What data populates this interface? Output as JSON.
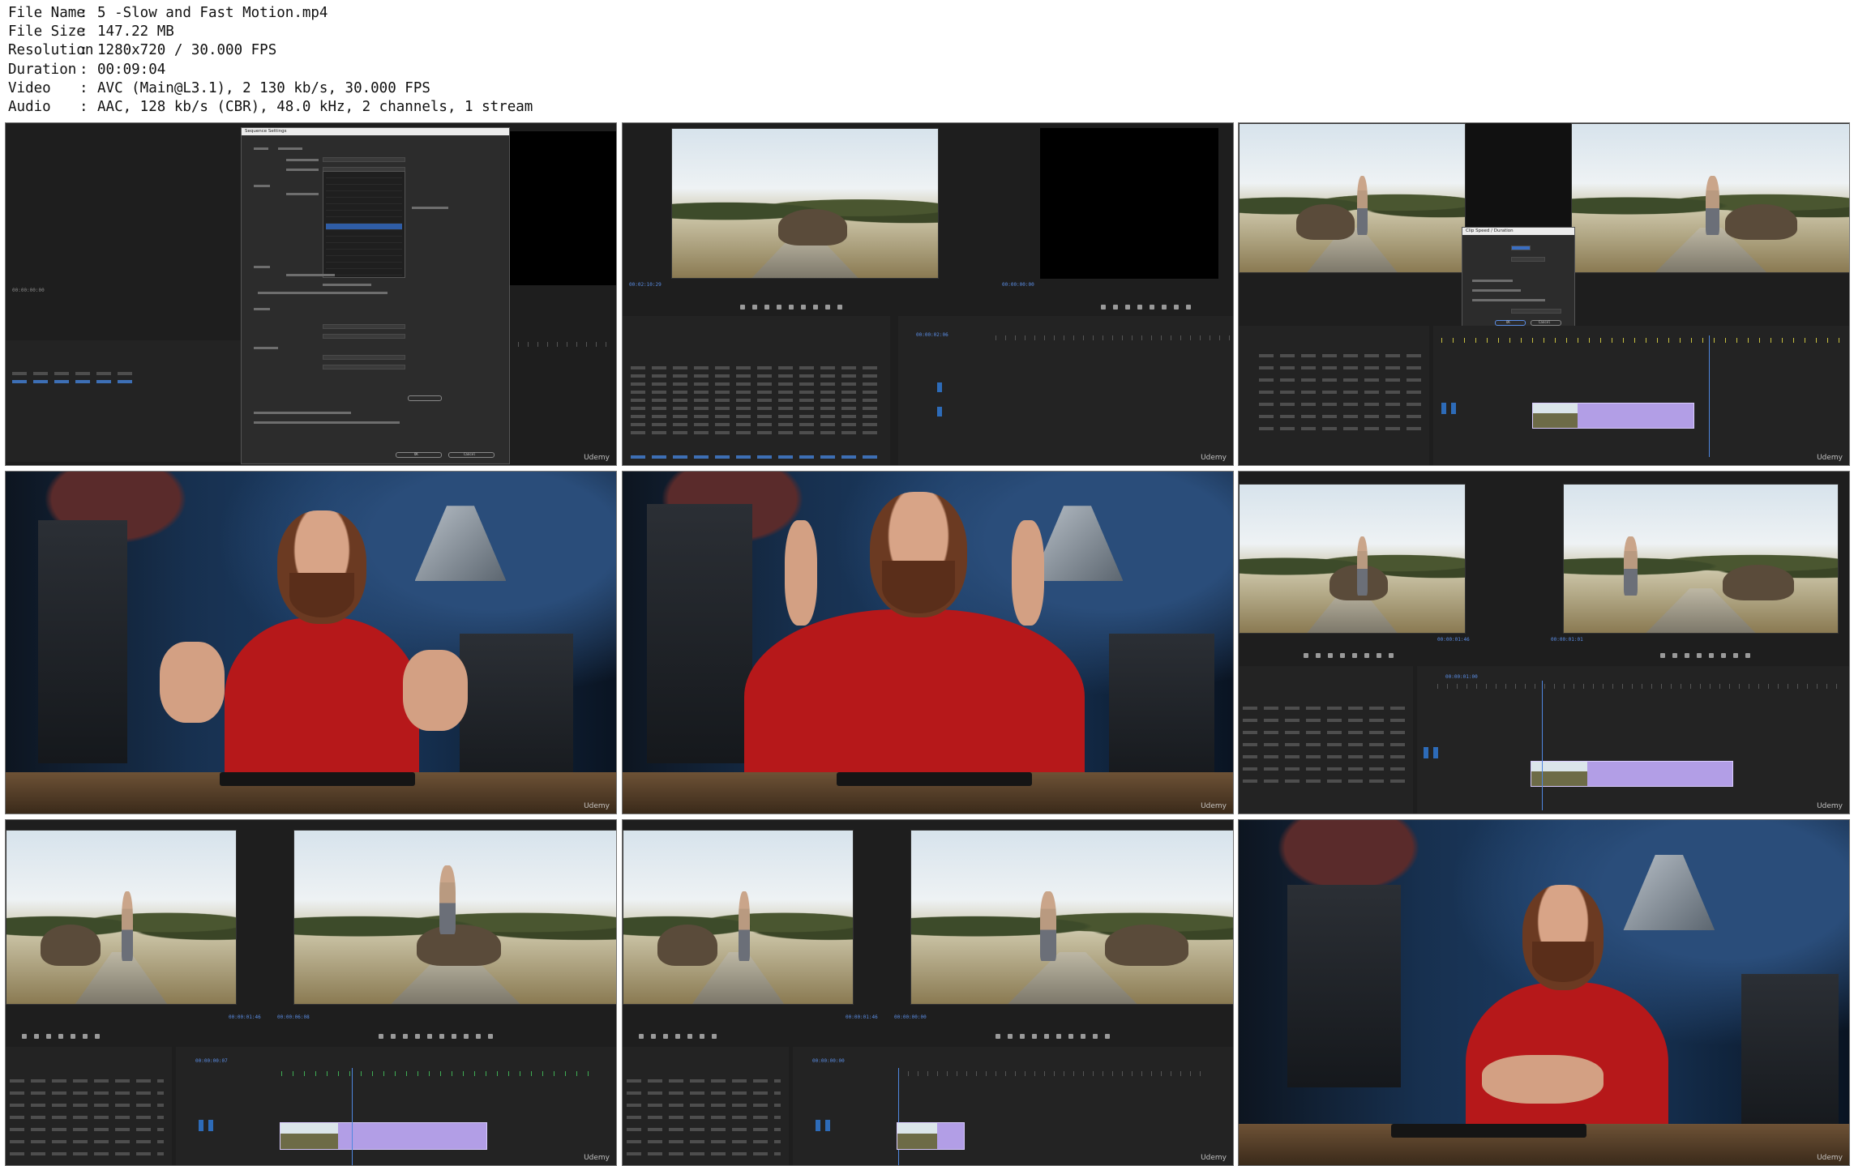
{
  "media_info": {
    "rows": [
      {
        "key": "File Name",
        "sep": ":",
        "value": "5 -Slow and Fast Motion.mp4"
      },
      {
        "key": "File Size",
        "sep": ":",
        "value": "147.22 MB"
      },
      {
        "key": "Resolution",
        "sep": ":",
        "value": "1280x720 / 30.000 FPS"
      },
      {
        "key": "Duration",
        "sep": ":",
        "value": "00:09:04"
      },
      {
        "key": "Video",
        "sep": ":",
        "value": "AVC (Main@L3.1), 2 130 kb/s, 30.000 FPS"
      },
      {
        "key": "Audio",
        "sep": ":",
        "value": "AAC, 128 kb/s (CBR), 48.0 kHz, 2 channels, 1 stream"
      }
    ]
  },
  "thumbnails": {
    "watermark": "Udemy",
    "t1": {
      "dialog_title": "Sequence Settings",
      "ok": "OK",
      "cancel": "Cancel",
      "timecode": "00:00:00:00"
    },
    "t2": {
      "timecode_left": "00:02:10:29",
      "timecode_right": "00:00:00:00",
      "timeline_tc": "00:00:02:06"
    },
    "t3": {
      "dialog_title": "Clip Speed / Duration",
      "ok": "OK",
      "cancel": "Cancel"
    },
    "t6": {
      "timecode_left": "00:00:01:46",
      "timecode_right": "00:00:01:01",
      "timeline_tc": "00:00:01:00"
    },
    "t7": {
      "timecode_left": "00:00:01:46",
      "timecode_right": "00:00:06:08",
      "timeline_tc": "00:00:00:07"
    },
    "t8": {
      "timecode_left": "00:00:01:46",
      "timecode_right": "00:00:00:00",
      "timeline_tc": "00:00:00:00"
    }
  },
  "colors": {
    "timecode_blue": "#5b8ee6",
    "clip_purple": "#b29ee6",
    "shirt_red": "#b6181a",
    "premiere_bg": "#1e1e1e"
  }
}
